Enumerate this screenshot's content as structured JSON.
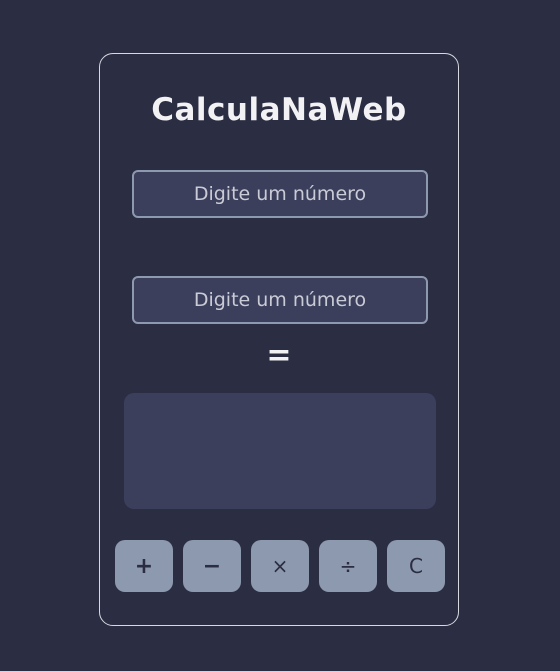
{
  "app": {
    "title": "CalculaNaWeb"
  },
  "inputs": {
    "first": {
      "placeholder": "Digite um número",
      "value": ""
    },
    "second": {
      "placeholder": "Digite um número",
      "value": ""
    }
  },
  "equals_sign": "=",
  "result": {
    "value": ""
  },
  "operations": {
    "add": "+",
    "subtract": "−",
    "multiply": "×",
    "divide": "÷",
    "clear": "C"
  },
  "colors": {
    "background": "#2b2d42",
    "panel": "#3c3f5c",
    "button": "#8d99ae",
    "text": "#f2f2f5"
  }
}
